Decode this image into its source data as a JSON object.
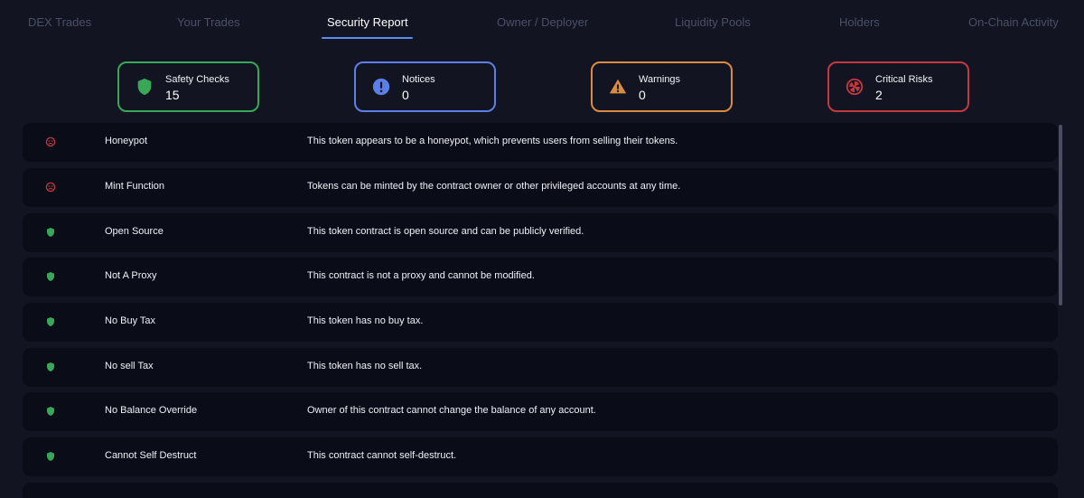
{
  "tabs": [
    {
      "label": "DEX Trades"
    },
    {
      "label": "Your Trades"
    },
    {
      "label": "Security Report"
    },
    {
      "label": "Owner / Deployer"
    },
    {
      "label": "Liquidity Pools"
    },
    {
      "label": "Holders"
    },
    {
      "label": "On-Chain Activity"
    }
  ],
  "active_tab": "Security Report",
  "summary": {
    "safety": {
      "label": "Safety Checks",
      "count": "15",
      "color": "#3aa657",
      "icon": "shield-icon"
    },
    "notices": {
      "label": "Notices",
      "count": "0",
      "color": "#5b7fe6",
      "icon": "info-icon"
    },
    "warnings": {
      "label": "Warnings",
      "count": "0",
      "color": "#d98c3f",
      "icon": "warning-icon"
    },
    "critical": {
      "label": "Critical Risks",
      "count": "2",
      "color": "#c1393f",
      "icon": "radiation-icon"
    }
  },
  "checks": [
    {
      "title": "Honeypot",
      "description": "This token appears to be a honeypot, which prevents users from selling their tokens.",
      "status": "critical"
    },
    {
      "title": "Mint Function",
      "description": "Tokens can be minted by the contract owner or other privileged accounts at any time.",
      "status": "critical"
    },
    {
      "title": "Open Source",
      "description": "This token contract is open source and can be publicly verified.",
      "status": "safe"
    },
    {
      "title": "Not A Proxy",
      "description": "This contract is not a proxy and cannot be modified.",
      "status": "safe"
    },
    {
      "title": "No Buy Tax",
      "description": "This token has no buy tax.",
      "status": "safe"
    },
    {
      "title": "No sell Tax",
      "description": "This token has no sell tax.",
      "status": "safe"
    },
    {
      "title": "No Balance Override",
      "description": "Owner of this contract cannot change the balance of any account.",
      "status": "safe"
    },
    {
      "title": "Cannot Self Destruct",
      "description": "This contract cannot self-destruct.",
      "status": "safe"
    },
    {
      "title": "",
      "description": "",
      "status": "safe"
    }
  ]
}
